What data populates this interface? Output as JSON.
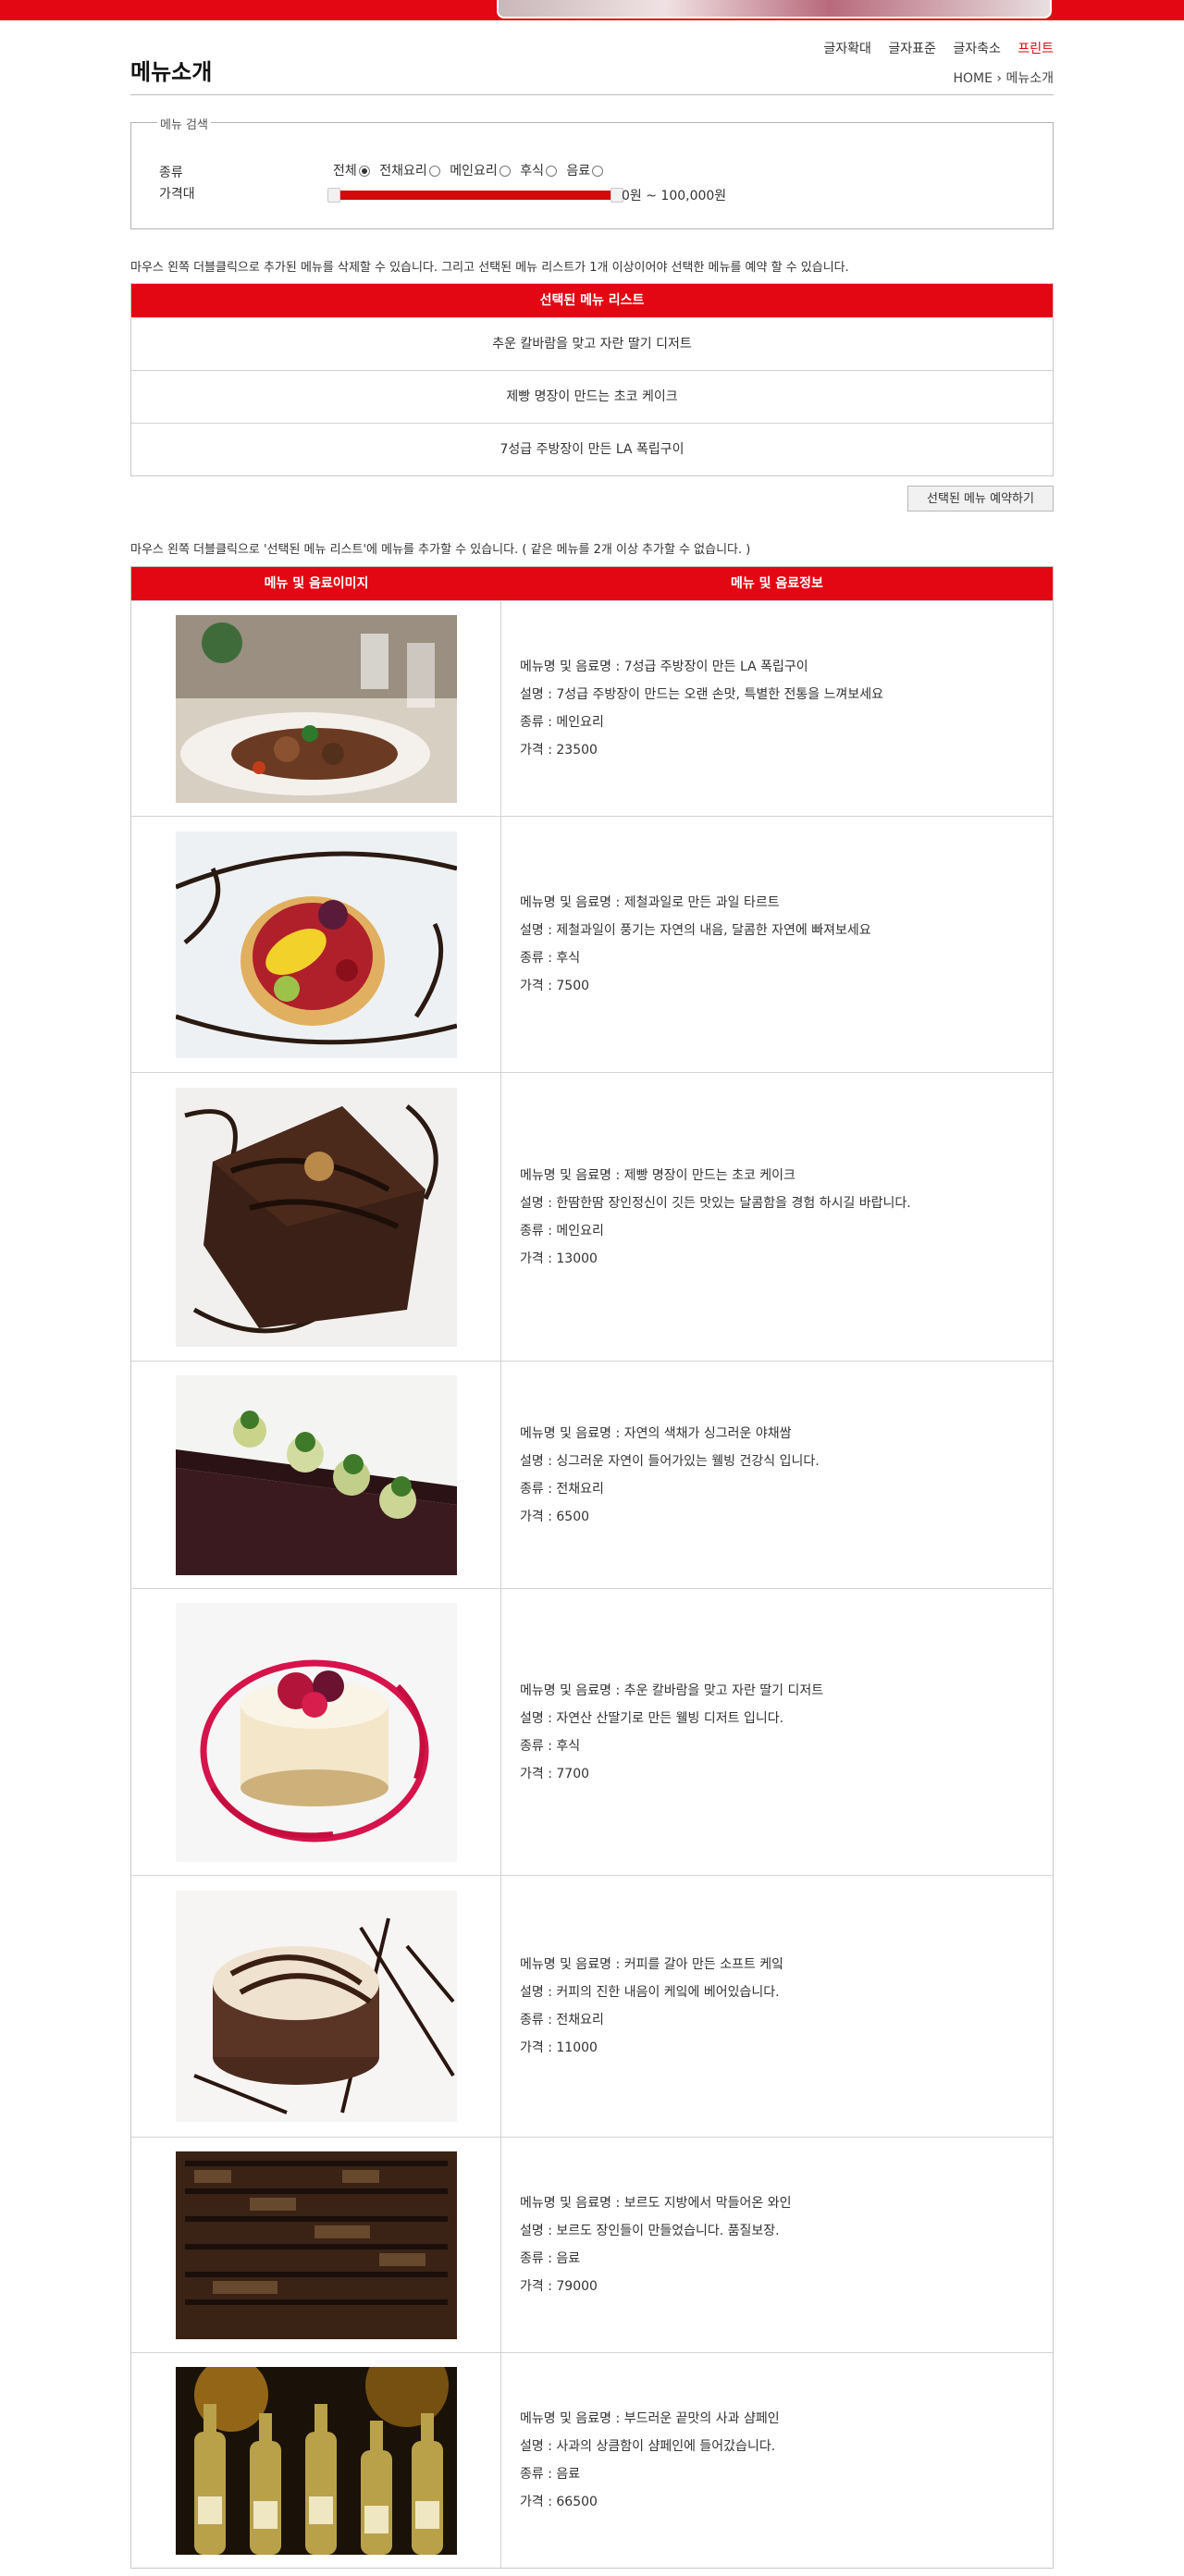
{
  "toplinks": {
    "zoom_in": "글자확대",
    "zoom_normal": "글자표준",
    "zoom_out": "글자축소",
    "print": "프린트"
  },
  "page_title": "메뉴소개",
  "breadcrumb": {
    "home": "HOME",
    "current": "메뉴소개"
  },
  "search": {
    "legend": "메뉴 검색",
    "category_label": "종류",
    "price_label": "가격대",
    "options": [
      {
        "label": "전체",
        "selected": true
      },
      {
        "label": "전채요리",
        "selected": false
      },
      {
        "label": "메인요리",
        "selected": false
      },
      {
        "label": "후식",
        "selected": false
      },
      {
        "label": "음료",
        "selected": false
      }
    ],
    "price_range_text": "0원 ~ 100,000원"
  },
  "notes": {
    "selected_help": "마우스 왼쪽 더블클릭으로 추가된 메뉴를 삭제할 수 있습니다. 그리고 선택된 메뉴 리스트가 1개 이상이어야 선택한 메뉴를 예약 할 수 있습니다.",
    "menu_help": "마우스 왼쪽 더블클릭으로 '선택된 메뉴 리스트'에 메뉴를 추가할 수 있습니다. ( 같은 메뉴를 2개 이상 추가할 수 없습니다. )"
  },
  "selected_list": {
    "header": "선택된 메뉴 리스트",
    "items": [
      "추운 칼바람을 맞고 자란 딸기 디저트",
      "제빵 명장이 만드는 초코 케이크",
      "7성급 주방장이 만든 LA 폭립구이"
    ]
  },
  "reserve_button": "선택된 메뉴 예약하기",
  "menu_table": {
    "header_image": "메뉴 및 음료이미지",
    "header_info": "메뉴 및 음료정보",
    "field_labels": {
      "name": "메뉴명 및 음료명 : ",
      "desc": "설명 : ",
      "category": "종류 : ",
      "price": "가격 : "
    },
    "items": [
      {
        "name": "7성급 주방장이 만든 LA 폭립구이",
        "desc": "7성급 주방장이 만드는 오랜 손맛, 특별한 전통을 느껴보세요",
        "category": "메인요리",
        "price": "23500",
        "image_icon": "ribs-plate-photo"
      },
      {
        "name": "제철과일로 만든 과일 타르트",
        "desc": "제철과일이 풍기는 자연의 내음, 달콤한 자연에 빠져보세요",
        "category": "후식",
        "price": "7500",
        "image_icon": "fruit-tart-photo"
      },
      {
        "name": "제빵 명장이 만드는 초코 케이크",
        "desc": "한땀한땀 장인정신이 깃든 맛있는 달콤함을 경험 하시길 바랍니다.",
        "category": "메인요리",
        "price": "13000",
        "image_icon": "chocolate-cake-photo"
      },
      {
        "name": "자연의 색채가 싱그러운 야채쌈",
        "desc": "싱그러운 자연이 들어가있는 웰빙 건강식 입니다.",
        "category": "전채요리",
        "price": "6500",
        "image_icon": "vegetable-wrap-photo"
      },
      {
        "name": "추운 칼바람을 맞고 자란 딸기 디저트",
        "desc": "자연산 산딸기로 만든 웰빙 디저트 입니다.",
        "category": "후식",
        "price": "7700",
        "image_icon": "berry-cheesecake-photo"
      },
      {
        "name": "커피를 갈아 만든 소프트 케잌",
        "desc": "커피의 진한 내음이 케잌에 베어있습니다.",
        "category": "전채요리",
        "price": "11000",
        "image_icon": "coffee-cake-photo"
      },
      {
        "name": "보르도 지방에서 막들어온 와인",
        "desc": "보르도 장인들이 만들었습니다. 품질보장.",
        "category": "음료",
        "price": "79000",
        "image_icon": "wine-cellar-photo"
      },
      {
        "name": "부드러운 끝맛의 사과 샴페인",
        "desc": "사과의 상큼함이 샴페인에 들어갔습니다.",
        "category": "음료",
        "price": "66500",
        "image_icon": "champagne-bottles-photo"
      }
    ]
  }
}
